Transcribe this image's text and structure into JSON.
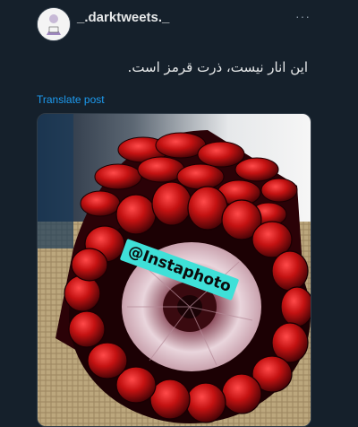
{
  "post": {
    "username": "_.darktweets._",
    "more_label": "···",
    "text": "این انار نیست، ذرت قرمز است.",
    "translate_label": "Translate post",
    "media": {
      "watermark": "@Instaphoto"
    }
  },
  "icons": {
    "avatar": "avatar-image",
    "more": "more-options-icon"
  }
}
